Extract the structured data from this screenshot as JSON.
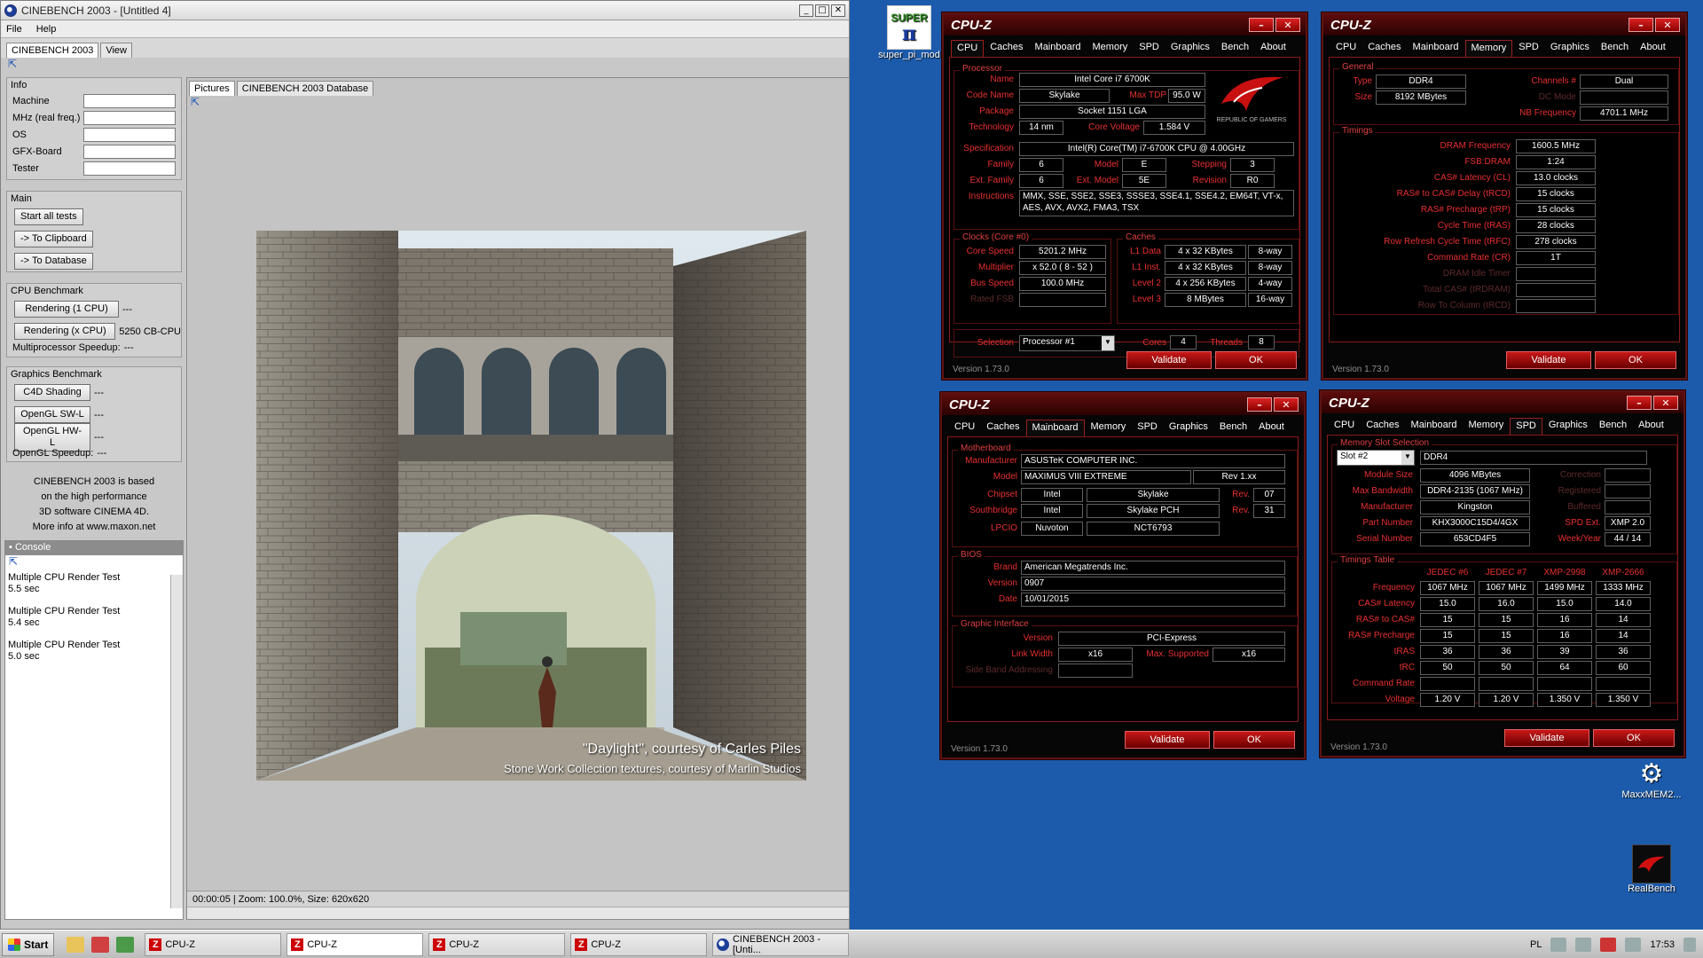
{
  "cinebench": {
    "title": "CINEBENCH 2003 - [Untitled 4]",
    "menu": [
      "File",
      "Help"
    ],
    "tabs": [
      "CINEBENCH 2003",
      "View"
    ],
    "info": {
      "heading": "Info",
      "fields": [
        "Machine",
        "MHz (real freq.)",
        "OS",
        "GFX-Board",
        "Tester"
      ]
    },
    "main": {
      "heading": "Main",
      "start_all": "Start all tests",
      "to_clipboard": "-> To Clipboard",
      "to_database": "-> To Database"
    },
    "cpu_benchmark": {
      "heading": "CPU Benchmark",
      "rendering_1": "Rendering (1 CPU)",
      "rendering_1_result": "---",
      "rendering_x": "Rendering (x CPU)",
      "rendering_x_result": "5250 CB-CPU",
      "mp_speedup_label": "Multiprocessor Speedup:",
      "mp_speedup_value": "---"
    },
    "graphics_benchmark": {
      "heading": "Graphics Benchmark",
      "c4d": "C4D Shading",
      "c4d_result": "---",
      "swl": "OpenGL SW-L",
      "swl_result": "---",
      "hwl": "OpenGL HW-L",
      "hwl_result": "---",
      "speedup_label": "OpenGL Speedup:",
      "speedup_value": "---"
    },
    "about": [
      "CINEBENCH 2003 is based",
      "on the high performance",
      "3D software CINEMA 4D.",
      "More info at www.maxon.net"
    ],
    "console": {
      "heading": "Console",
      "entries": [
        {
          "name": "Multiple CPU Render Test",
          "time": "5.5 sec"
        },
        {
          "name": "Multiple CPU Render Test",
          "time": "5.4 sec"
        },
        {
          "name": "Multiple CPU Render Test",
          "time": "5.0 sec"
        }
      ]
    },
    "picture_tabs": [
      "Pictures",
      "CINEBENCH 2003 Database"
    ],
    "caption1": "\"Daylight\", courtesy of Carles Piles",
    "caption2": "Stone Work Collection textures, courtesy of Marlin Studios",
    "status": "00:00:05 | Zoom: 100.0%, Size: 620x620"
  },
  "cpuz_common": {
    "title": "CPU-Z",
    "tabs": [
      "CPU",
      "Caches",
      "Mainboard",
      "Memory",
      "SPD",
      "Graphics",
      "Bench",
      "About"
    ],
    "validate": "Validate",
    "ok": "OK",
    "version": "Version 1.73.0"
  },
  "cpuz_cpu": {
    "processor_heading": "Processor",
    "name_label": "Name",
    "name": "Intel Core i7 6700K",
    "codename_label": "Code Name",
    "codename": "Skylake",
    "maxtdp_label": "Max TDP",
    "maxtdp": "95.0 W",
    "package_label": "Package",
    "package": "Socket 1151 LGA",
    "tech_label": "Technology",
    "tech": "14 nm",
    "voltage_label": "Core Voltage",
    "voltage": "1.584 V",
    "spec_label": "Specification",
    "spec": "Intel(R) Core(TM) i7-6700K CPU @ 4.00GHz",
    "family_label": "Family",
    "family": "6",
    "model_label": "Model",
    "model": "E",
    "stepping_label": "Stepping",
    "stepping": "3",
    "extfamily_label": "Ext. Family",
    "extfamily": "6",
    "extmodel_label": "Ext. Model",
    "extmodel": "5E",
    "revision_label": "Revision",
    "revision": "R0",
    "instr_label": "Instructions",
    "instr": "MMX, SSE, SSE2, SSE3, SSSE3, SSE4.1, SSE4.2, EM64T, VT-x, AES, AVX, AVX2, FMA3, TSX",
    "clocks_heading": "Clocks (Core #0)",
    "corespeed_label": "Core Speed",
    "corespeed": "5201.2 MHz",
    "multiplier_label": "Multiplier",
    "multiplier": "x 52.0 ( 8 - 52 )",
    "busspeed_label": "Bus Speed",
    "busspeed": "100.0 MHz",
    "ratedfsb_label": "Rated FSB",
    "caches_heading": "Caches",
    "l1d_label": "L1 Data",
    "l1d": "4 x 32 KBytes",
    "l1d_way": "8-way",
    "l1i_label": "L1 Inst.",
    "l1i": "4 x 32 KBytes",
    "l1i_way": "8-way",
    "l2_label": "Level 2",
    "l2": "4 x 256 KBytes",
    "l2_way": "4-way",
    "l3_label": "Level 3",
    "l3": "8 MBytes",
    "l3_way": "16-way",
    "selection_label": "Selection",
    "selection": "Processor #1",
    "cores_label": "Cores",
    "cores": "4",
    "threads_label": "Threads",
    "threads": "8",
    "rog_text": "REPUBLIC OF GAMERS"
  },
  "cpuz_memory": {
    "general_heading": "General",
    "type_label": "Type",
    "type": "DDR4",
    "channels_label": "Channels #",
    "channels": "Dual",
    "size_label": "Size",
    "size": "8192 MBytes",
    "dcmode_label": "DC Mode",
    "nbfreq_label": "NB Frequency",
    "nbfreq": "4701.1 MHz",
    "timings_heading": "Timings",
    "rows": [
      {
        "label": "DRAM Frequency",
        "value": "1600.5 MHz",
        "dim": false
      },
      {
        "label": "FSB:DRAM",
        "value": "1:24",
        "dim": false
      },
      {
        "label": "CAS# Latency (CL)",
        "value": "13.0 clocks",
        "dim": false
      },
      {
        "label": "RAS# to CAS# Delay (tRCD)",
        "value": "15 clocks",
        "dim": false
      },
      {
        "label": "RAS# Precharge (tRP)",
        "value": "15 clocks",
        "dim": false
      },
      {
        "label": "Cycle Time (tRAS)",
        "value": "28 clocks",
        "dim": false
      },
      {
        "label": "Row Refresh Cycle Time (tRFC)",
        "value": "278 clocks",
        "dim": false
      },
      {
        "label": "Command Rate (CR)",
        "value": "1T",
        "dim": false
      },
      {
        "label": "DRAM Idle Timer",
        "value": "",
        "dim": true
      },
      {
        "label": "Total CAS# (tRDRAM)",
        "value": "",
        "dim": true
      },
      {
        "label": "Row To Column (tRCD)",
        "value": "",
        "dim": true
      }
    ]
  },
  "cpuz_mainboard": {
    "mb_heading": "Motherboard",
    "manufacturer_label": "Manufacturer",
    "manufacturer": "ASUSTeK COMPUTER INC.",
    "model_label": "Model",
    "model": "MAXIMUS VIII EXTREME",
    "model_rev": "Rev 1.xx",
    "chipset_label": "Chipset",
    "chipset_vendor": "Intel",
    "chipset": "Skylake",
    "chipset_rev_label": "Rev.",
    "chipset_rev": "07",
    "sb_label": "Southbridge",
    "sb_vendor": "Intel",
    "sb": "Skylake PCH",
    "sb_rev_label": "Rev.",
    "sb_rev": "31",
    "lpcio_label": "LPCIO",
    "lpcio_vendor": "Nuvoton",
    "lpcio": "NCT6793",
    "bios_heading": "BIOS",
    "brand_label": "Brand",
    "brand": "American Megatrends Inc.",
    "version_label": "Version",
    "version": "0907",
    "date_label": "Date",
    "date": "10/01/2015",
    "gi_heading": "Graphic Interface",
    "gi_version_label": "Version",
    "gi_version": "PCI-Express",
    "linkwidth_label": "Link Width",
    "linkwidth": "x16",
    "maxsupported_label": "Max. Supported",
    "maxsupported": "x16",
    "sideband_label": "Side Band Addressing"
  },
  "cpuz_spd": {
    "slot_heading": "Memory Slot Selection",
    "slot": "Slot #2",
    "slot_type": "DDR4",
    "modsize_label": "Module Size",
    "modsize": "4096 MBytes",
    "correction_label": "Correction",
    "maxbw_label": "Max Bandwidth",
    "maxbw": "DDR4-2135 (1067 MHz)",
    "registered_label": "Registered",
    "manufacturer_label": "Manufacturer",
    "manufacturer": "Kingston",
    "buffered_label": "Buffered",
    "partnum_label": "Part Number",
    "partnum": "KHX3000C15D4/4GX",
    "spdext_label": "SPD Ext.",
    "spdext": "XMP 2.0",
    "serial_label": "Serial Number",
    "serial": "653CD4F5",
    "weekyear_label": "Week/Year",
    "weekyear": "44 / 14",
    "timings_heading": "Timings Table",
    "columns": [
      "JEDEC #6",
      "JEDEC #7",
      "XMP-2998",
      "XMP-2666"
    ],
    "rows": [
      {
        "label": "Frequency",
        "values": [
          "1067 MHz",
          "1067 MHz",
          "1499 MHz",
          "1333 MHz"
        ]
      },
      {
        "label": "CAS# Latency",
        "values": [
          "15.0",
          "16.0",
          "15.0",
          "14.0"
        ]
      },
      {
        "label": "RAS# to CAS#",
        "values": [
          "15",
          "15",
          "16",
          "14"
        ]
      },
      {
        "label": "RAS# Precharge",
        "values": [
          "15",
          "15",
          "16",
          "14"
        ]
      },
      {
        "label": "tRAS",
        "values": [
          "36",
          "36",
          "39",
          "36"
        ]
      },
      {
        "label": "tRC",
        "values": [
          "50",
          "50",
          "64",
          "60"
        ]
      },
      {
        "label": "Command Rate",
        "values": [
          "",
          "",
          "",
          ""
        ]
      },
      {
        "label": "Voltage",
        "values": [
          "1.20 V",
          "1.20 V",
          "1.350 V",
          "1.350 V"
        ]
      }
    ]
  },
  "desktop": {
    "superpi_label": "super_pi_mod",
    "superpi_logo": "SUPER",
    "maxxmem_label": "MaxxMEM2...",
    "realbench_label": "RealBench"
  },
  "taskbar": {
    "start": "Start",
    "items": [
      "CPU-Z",
      "CPU-Z",
      "CPU-Z",
      "CPU-Z",
      "CINEBENCH 2003 - [Unti..."
    ],
    "lang": "PL",
    "clock": "17:53"
  }
}
